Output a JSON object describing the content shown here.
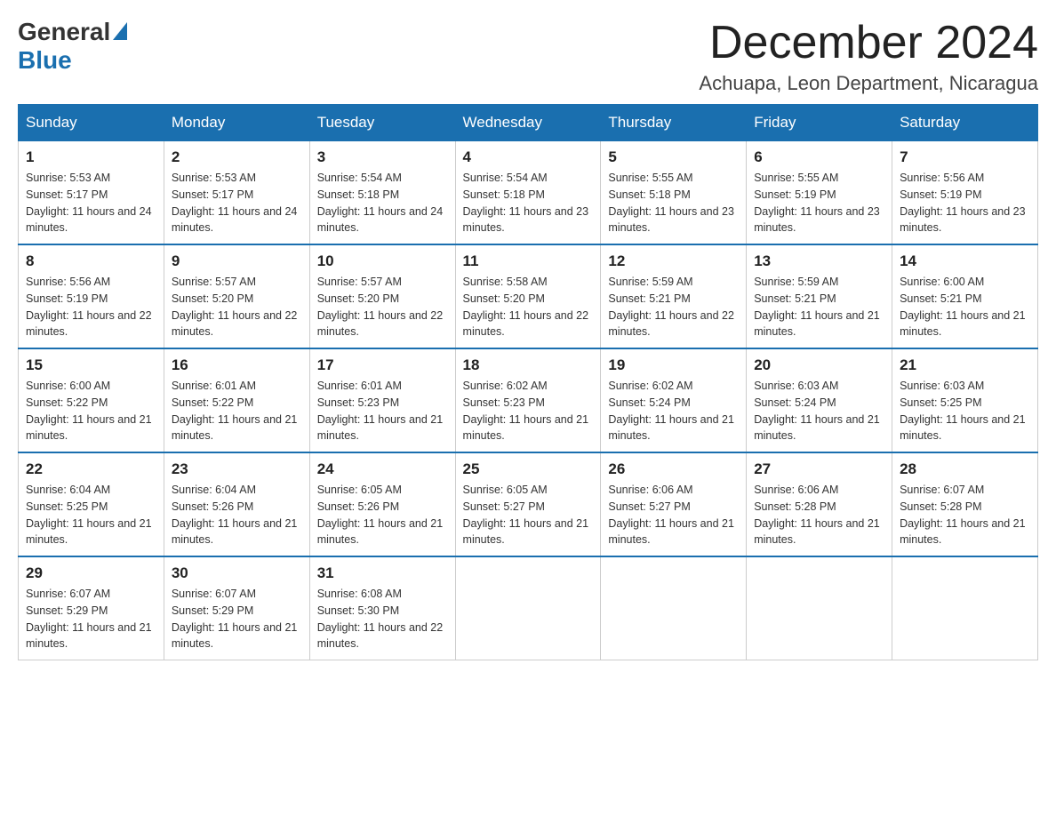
{
  "header": {
    "logo_general": "General",
    "logo_blue": "Blue",
    "month_title": "December 2024",
    "location": "Achuapa, Leon Department, Nicaragua"
  },
  "calendar": {
    "days_of_week": [
      "Sunday",
      "Monday",
      "Tuesday",
      "Wednesday",
      "Thursday",
      "Friday",
      "Saturday"
    ],
    "weeks": [
      [
        {
          "date": "1",
          "sunrise": "Sunrise: 5:53 AM",
          "sunset": "Sunset: 5:17 PM",
          "daylight": "Daylight: 11 hours and 24 minutes."
        },
        {
          "date": "2",
          "sunrise": "Sunrise: 5:53 AM",
          "sunset": "Sunset: 5:17 PM",
          "daylight": "Daylight: 11 hours and 24 minutes."
        },
        {
          "date": "3",
          "sunrise": "Sunrise: 5:54 AM",
          "sunset": "Sunset: 5:18 PM",
          "daylight": "Daylight: 11 hours and 24 minutes."
        },
        {
          "date": "4",
          "sunrise": "Sunrise: 5:54 AM",
          "sunset": "Sunset: 5:18 PM",
          "daylight": "Daylight: 11 hours and 23 minutes."
        },
        {
          "date": "5",
          "sunrise": "Sunrise: 5:55 AM",
          "sunset": "Sunset: 5:18 PM",
          "daylight": "Daylight: 11 hours and 23 minutes."
        },
        {
          "date": "6",
          "sunrise": "Sunrise: 5:55 AM",
          "sunset": "Sunset: 5:19 PM",
          "daylight": "Daylight: 11 hours and 23 minutes."
        },
        {
          "date": "7",
          "sunrise": "Sunrise: 5:56 AM",
          "sunset": "Sunset: 5:19 PM",
          "daylight": "Daylight: 11 hours and 23 minutes."
        }
      ],
      [
        {
          "date": "8",
          "sunrise": "Sunrise: 5:56 AM",
          "sunset": "Sunset: 5:19 PM",
          "daylight": "Daylight: 11 hours and 22 minutes."
        },
        {
          "date": "9",
          "sunrise": "Sunrise: 5:57 AM",
          "sunset": "Sunset: 5:20 PM",
          "daylight": "Daylight: 11 hours and 22 minutes."
        },
        {
          "date": "10",
          "sunrise": "Sunrise: 5:57 AM",
          "sunset": "Sunset: 5:20 PM",
          "daylight": "Daylight: 11 hours and 22 minutes."
        },
        {
          "date": "11",
          "sunrise": "Sunrise: 5:58 AM",
          "sunset": "Sunset: 5:20 PM",
          "daylight": "Daylight: 11 hours and 22 minutes."
        },
        {
          "date": "12",
          "sunrise": "Sunrise: 5:59 AM",
          "sunset": "Sunset: 5:21 PM",
          "daylight": "Daylight: 11 hours and 22 minutes."
        },
        {
          "date": "13",
          "sunrise": "Sunrise: 5:59 AM",
          "sunset": "Sunset: 5:21 PM",
          "daylight": "Daylight: 11 hours and 21 minutes."
        },
        {
          "date": "14",
          "sunrise": "Sunrise: 6:00 AM",
          "sunset": "Sunset: 5:21 PM",
          "daylight": "Daylight: 11 hours and 21 minutes."
        }
      ],
      [
        {
          "date": "15",
          "sunrise": "Sunrise: 6:00 AM",
          "sunset": "Sunset: 5:22 PM",
          "daylight": "Daylight: 11 hours and 21 minutes."
        },
        {
          "date": "16",
          "sunrise": "Sunrise: 6:01 AM",
          "sunset": "Sunset: 5:22 PM",
          "daylight": "Daylight: 11 hours and 21 minutes."
        },
        {
          "date": "17",
          "sunrise": "Sunrise: 6:01 AM",
          "sunset": "Sunset: 5:23 PM",
          "daylight": "Daylight: 11 hours and 21 minutes."
        },
        {
          "date": "18",
          "sunrise": "Sunrise: 6:02 AM",
          "sunset": "Sunset: 5:23 PM",
          "daylight": "Daylight: 11 hours and 21 minutes."
        },
        {
          "date": "19",
          "sunrise": "Sunrise: 6:02 AM",
          "sunset": "Sunset: 5:24 PM",
          "daylight": "Daylight: 11 hours and 21 minutes."
        },
        {
          "date": "20",
          "sunrise": "Sunrise: 6:03 AM",
          "sunset": "Sunset: 5:24 PM",
          "daylight": "Daylight: 11 hours and 21 minutes."
        },
        {
          "date": "21",
          "sunrise": "Sunrise: 6:03 AM",
          "sunset": "Sunset: 5:25 PM",
          "daylight": "Daylight: 11 hours and 21 minutes."
        }
      ],
      [
        {
          "date": "22",
          "sunrise": "Sunrise: 6:04 AM",
          "sunset": "Sunset: 5:25 PM",
          "daylight": "Daylight: 11 hours and 21 minutes."
        },
        {
          "date": "23",
          "sunrise": "Sunrise: 6:04 AM",
          "sunset": "Sunset: 5:26 PM",
          "daylight": "Daylight: 11 hours and 21 minutes."
        },
        {
          "date": "24",
          "sunrise": "Sunrise: 6:05 AM",
          "sunset": "Sunset: 5:26 PM",
          "daylight": "Daylight: 11 hours and 21 minutes."
        },
        {
          "date": "25",
          "sunrise": "Sunrise: 6:05 AM",
          "sunset": "Sunset: 5:27 PM",
          "daylight": "Daylight: 11 hours and 21 minutes."
        },
        {
          "date": "26",
          "sunrise": "Sunrise: 6:06 AM",
          "sunset": "Sunset: 5:27 PM",
          "daylight": "Daylight: 11 hours and 21 minutes."
        },
        {
          "date": "27",
          "sunrise": "Sunrise: 6:06 AM",
          "sunset": "Sunset: 5:28 PM",
          "daylight": "Daylight: 11 hours and 21 minutes."
        },
        {
          "date": "28",
          "sunrise": "Sunrise: 6:07 AM",
          "sunset": "Sunset: 5:28 PM",
          "daylight": "Daylight: 11 hours and 21 minutes."
        }
      ],
      [
        {
          "date": "29",
          "sunrise": "Sunrise: 6:07 AM",
          "sunset": "Sunset: 5:29 PM",
          "daylight": "Daylight: 11 hours and 21 minutes."
        },
        {
          "date": "30",
          "sunrise": "Sunrise: 6:07 AM",
          "sunset": "Sunset: 5:29 PM",
          "daylight": "Daylight: 11 hours and 21 minutes."
        },
        {
          "date": "31",
          "sunrise": "Sunrise: 6:08 AM",
          "sunset": "Sunset: 5:30 PM",
          "daylight": "Daylight: 11 hours and 22 minutes."
        },
        null,
        null,
        null,
        null
      ]
    ]
  }
}
